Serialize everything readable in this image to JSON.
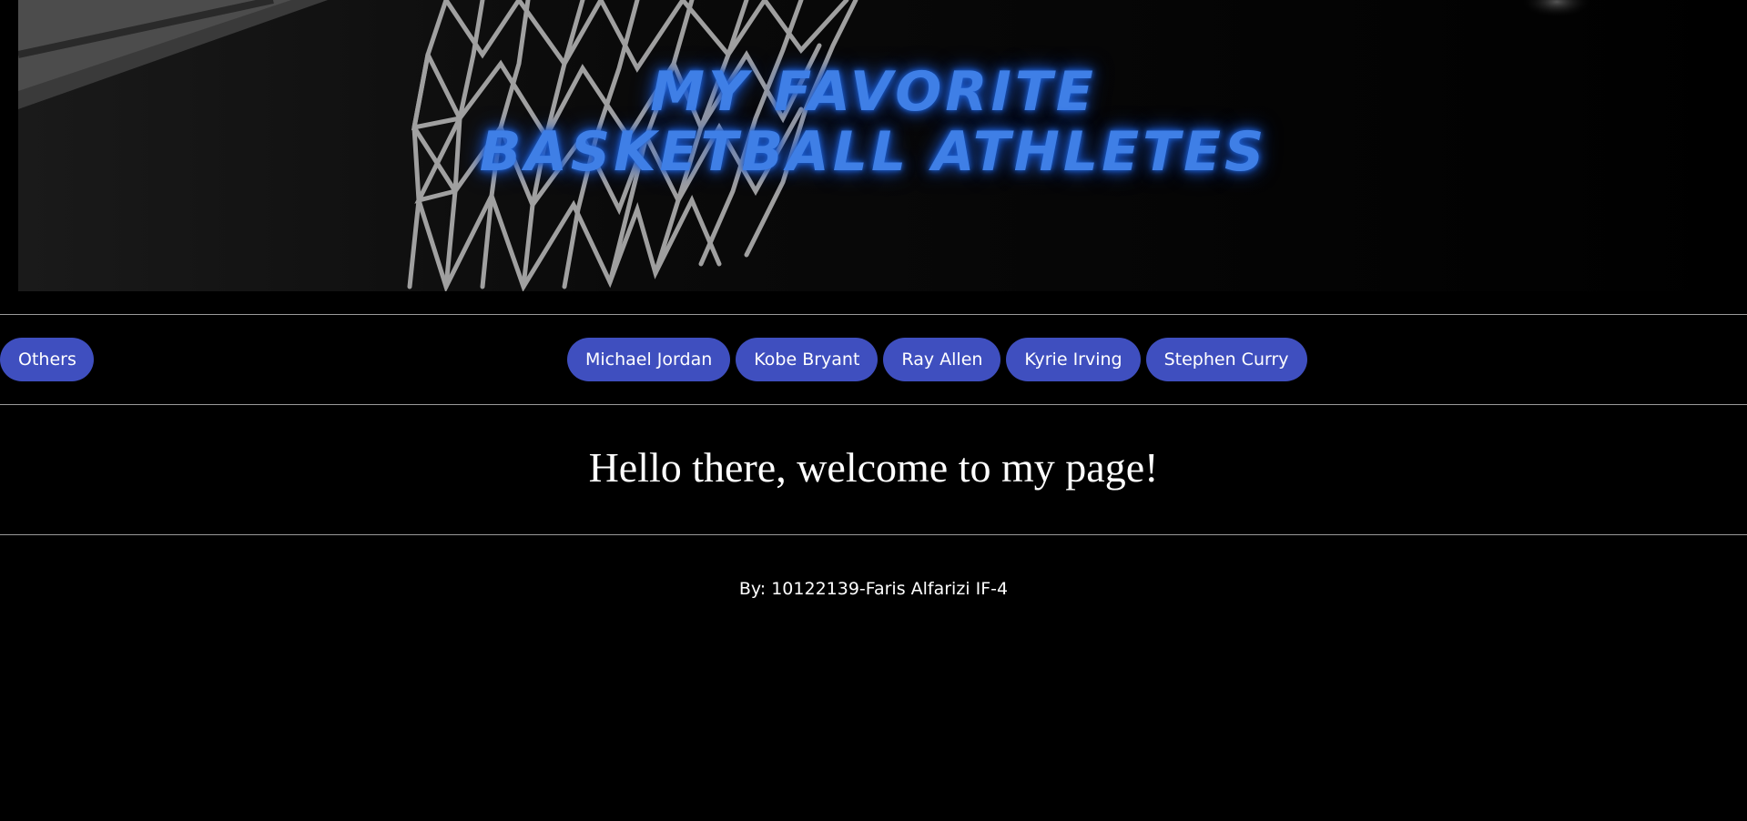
{
  "banner": {
    "title_line_1": "My Favorite",
    "title_line_2": "Basketball Athletes",
    "title_color": "#3f7fe6",
    "photo_subject": "basketball-net"
  },
  "nav": {
    "others_label": "Others",
    "items": [
      {
        "label": "Michael Jordan"
      },
      {
        "label": "Kobe Bryant"
      },
      {
        "label": "Ray Allen"
      },
      {
        "label": "Kyrie Irving"
      },
      {
        "label": "Stephen Curry"
      }
    ],
    "pill_color": "#3f4fbf"
  },
  "main": {
    "welcome_text": "Hello there, welcome to my page!"
  },
  "footer": {
    "byline": "By: 10122139-Faris Alfarizi IF-4"
  }
}
